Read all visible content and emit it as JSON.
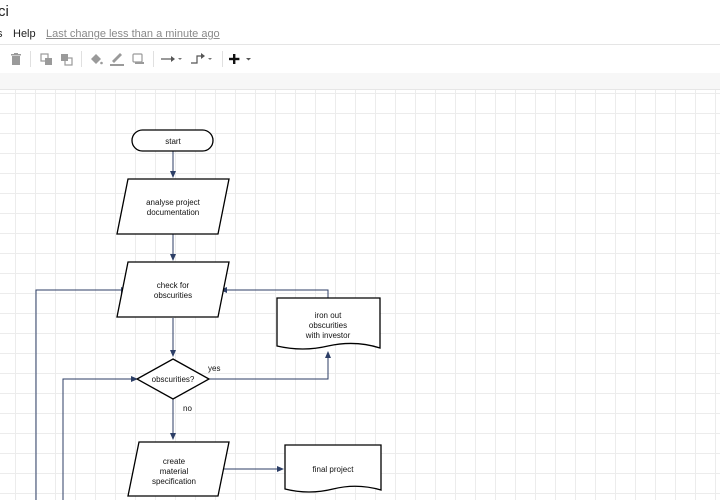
{
  "window": {
    "title": "ci"
  },
  "menu": {
    "items": [
      "s",
      "Help"
    ],
    "last_change": "Last change less than a minute ago"
  },
  "toolbar": {
    "icons": [
      "trash-icon",
      "to-front-icon",
      "to-back-icon",
      "fill-color-icon",
      "line-color-icon",
      "shadow-icon",
      "connection-icon",
      "waypoints-icon",
      "insert-icon"
    ],
    "colors": {
      "icon": "#9a9a9a",
      "insert": "#111111"
    }
  },
  "diagram": {
    "nodes": {
      "start": {
        "lines": [
          "start"
        ]
      },
      "analyse": {
        "lines": [
          "analyse project",
          "documentation"
        ]
      },
      "check": {
        "lines": [
          "check for",
          "obscurities"
        ]
      },
      "obscurities": {
        "lines": [
          "obscurities?"
        ]
      },
      "iron": {
        "lines": [
          "iron out",
          "obscurities",
          "with investor"
        ]
      },
      "create": {
        "lines": [
          "create",
          "material",
          "specification"
        ]
      },
      "final": {
        "lines": [
          "final project"
        ]
      }
    },
    "edge_labels": {
      "yes": "yes",
      "no": "no"
    },
    "colors": {
      "edge": "#2c3e66",
      "shape_stroke": "#000000",
      "grid": "#ececec"
    }
  }
}
